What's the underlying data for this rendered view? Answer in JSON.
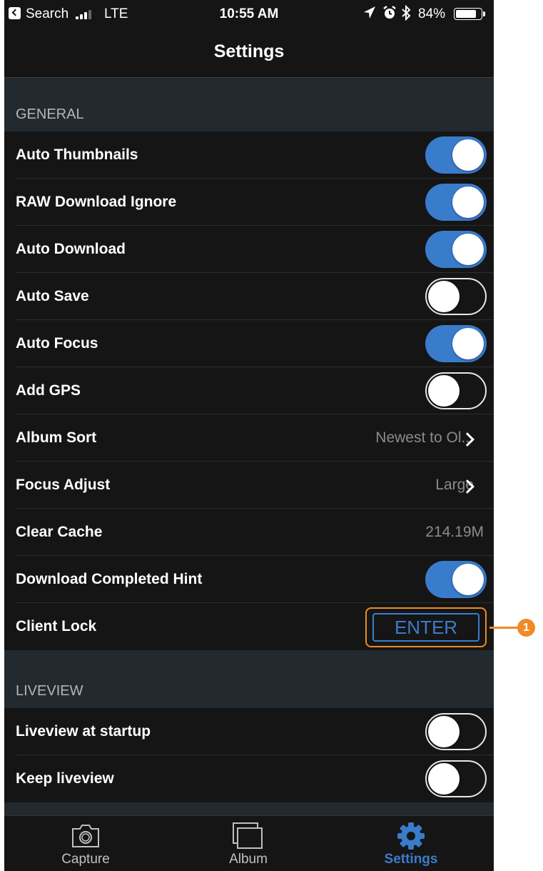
{
  "status_bar": {
    "back_app": "Search",
    "carrier": "LTE",
    "time": "10:55 AM",
    "battery_percent": "84%",
    "battery_level": 0.84
  },
  "nav": {
    "title": "Settings"
  },
  "sections": {
    "general": "GENERAL",
    "liveview": "LIVEVIEW"
  },
  "general_rows": {
    "auto_thumbnails": {
      "label": "Auto Thumbnails",
      "on": true
    },
    "raw_download_ignore": {
      "label": "RAW Download Ignore",
      "on": true
    },
    "auto_download": {
      "label": "Auto Download",
      "on": true
    },
    "auto_save": {
      "label": "Auto Save",
      "on": false
    },
    "auto_focus": {
      "label": "Auto Focus",
      "on": true
    },
    "add_gps": {
      "label": "Add GPS",
      "on": false
    },
    "album_sort": {
      "label": "Album Sort",
      "value": "Newest to Ol..."
    },
    "focus_adjust": {
      "label": "Focus Adjust",
      "value": "Large"
    },
    "clear_cache": {
      "label": "Clear Cache",
      "value": "214.19M"
    },
    "download_completed_hint": {
      "label": "Download Completed Hint",
      "on": true
    },
    "client_lock": {
      "label": "Client Lock",
      "button": "ENTER"
    }
  },
  "liveview_rows": {
    "liveview_at_startup": {
      "label": "Liveview at startup",
      "on": false
    },
    "keep_liveview": {
      "label": "Keep liveview",
      "on": false
    }
  },
  "tabs": {
    "capture": "Capture",
    "album": "Album",
    "settings": "Settings"
  },
  "callout": {
    "number": "1"
  },
  "colors": {
    "background": "#151515",
    "section_header": "#222a30",
    "accent_blue": "#3a7ccc",
    "callout_orange": "#f08a24"
  },
  "icons": {
    "capture": "camera-icon",
    "album": "album-icon",
    "settings": "gear-icon"
  }
}
